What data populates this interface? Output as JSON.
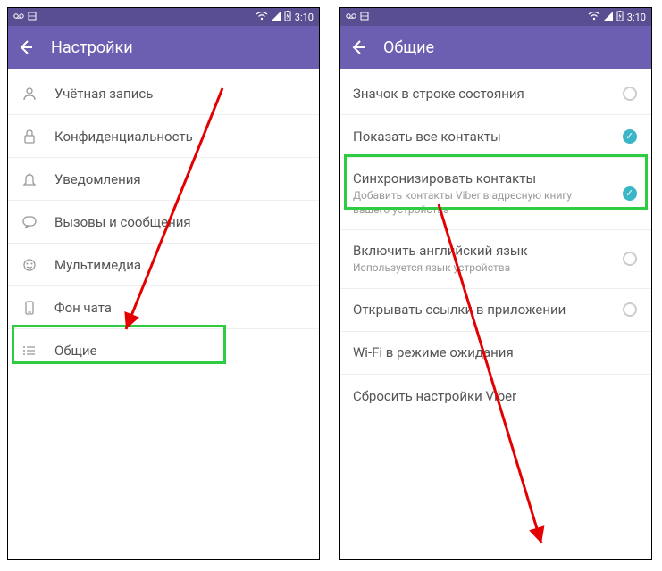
{
  "status": {
    "time": "3:10"
  },
  "screen1": {
    "title": "Настройки",
    "items": [
      {
        "label": "Учётная запись"
      },
      {
        "label": "Конфиденциальность"
      },
      {
        "label": "Уведомления"
      },
      {
        "label": "Вызовы и сообщения"
      },
      {
        "label": "Мультимедиа"
      },
      {
        "label": "Фон чата"
      },
      {
        "label": "Общие"
      }
    ]
  },
  "screen2": {
    "title": "Общие",
    "items": [
      {
        "label": "Значок в строке состояния",
        "sub": "",
        "checked": false
      },
      {
        "label": "Показать все контакты",
        "sub": "",
        "checked": true
      },
      {
        "label": "Синхронизировать контакты",
        "sub": "Добавить контакты Viber в адресную книгу вашего устройства",
        "checked": true
      },
      {
        "label": "Включить английский язык",
        "sub": "Используется язык устройства",
        "checked": false
      },
      {
        "label": "Открывать ссылки в приложении",
        "sub": "",
        "checked": false
      },
      {
        "label": "Wi-Fi в режиме ожидания",
        "sub": "",
        "checked": null
      },
      {
        "label": "Сбросить настройки Viber",
        "sub": "",
        "checked": null
      }
    ]
  }
}
